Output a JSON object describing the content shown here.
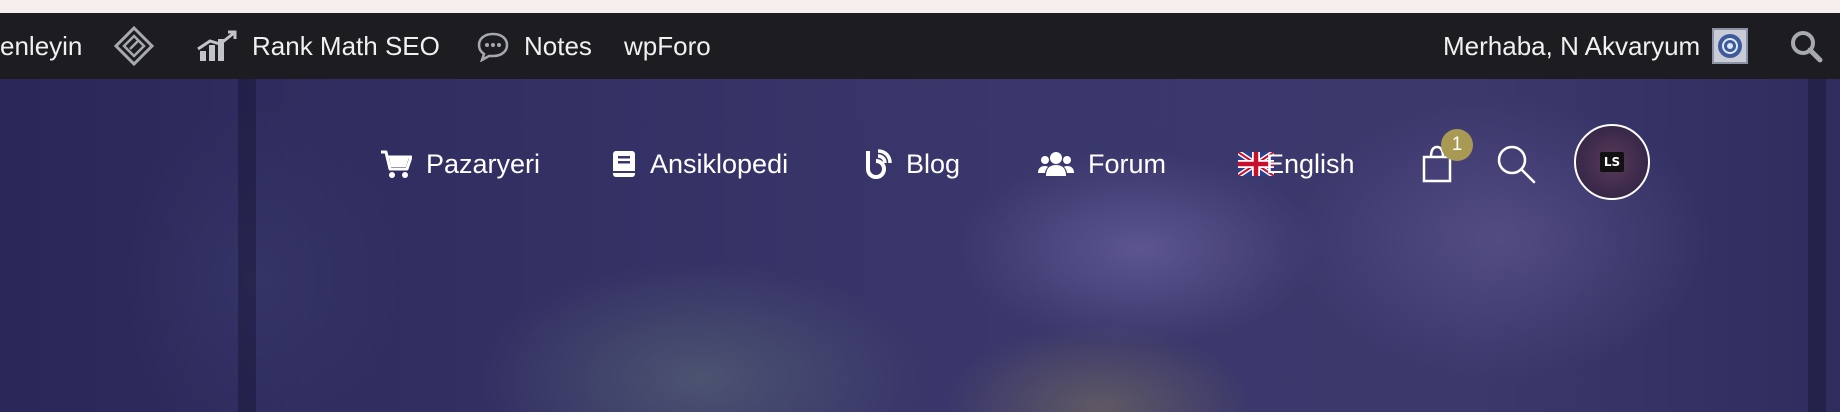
{
  "adminbar": {
    "partial_label": "enleyin",
    "plugin_icon": "diamond-logo-icon",
    "rankmath_label": "Rank Math SEO",
    "notes_label": "Notes",
    "wpforo_label": "wpForo",
    "greeting": "Merhaba, N Akvaryum",
    "search_icon": "search-icon"
  },
  "nav": {
    "items": [
      {
        "label": "Pazaryeri",
        "icon": "cart-icon"
      },
      {
        "label": "Ansiklopedi",
        "icon": "book-icon"
      },
      {
        "label": "Blog",
        "icon": "blog-icon"
      },
      {
        "label": "Forum",
        "icon": "users-icon"
      },
      {
        "label": "English",
        "icon": "uk-flag-icon"
      }
    ],
    "cart_count": "1",
    "avatar_initials": "LS"
  },
  "colors": {
    "adminbar_bg": "#1d1d21",
    "badge": "#a89a52",
    "hero_tint": "#2b2a5c"
  }
}
